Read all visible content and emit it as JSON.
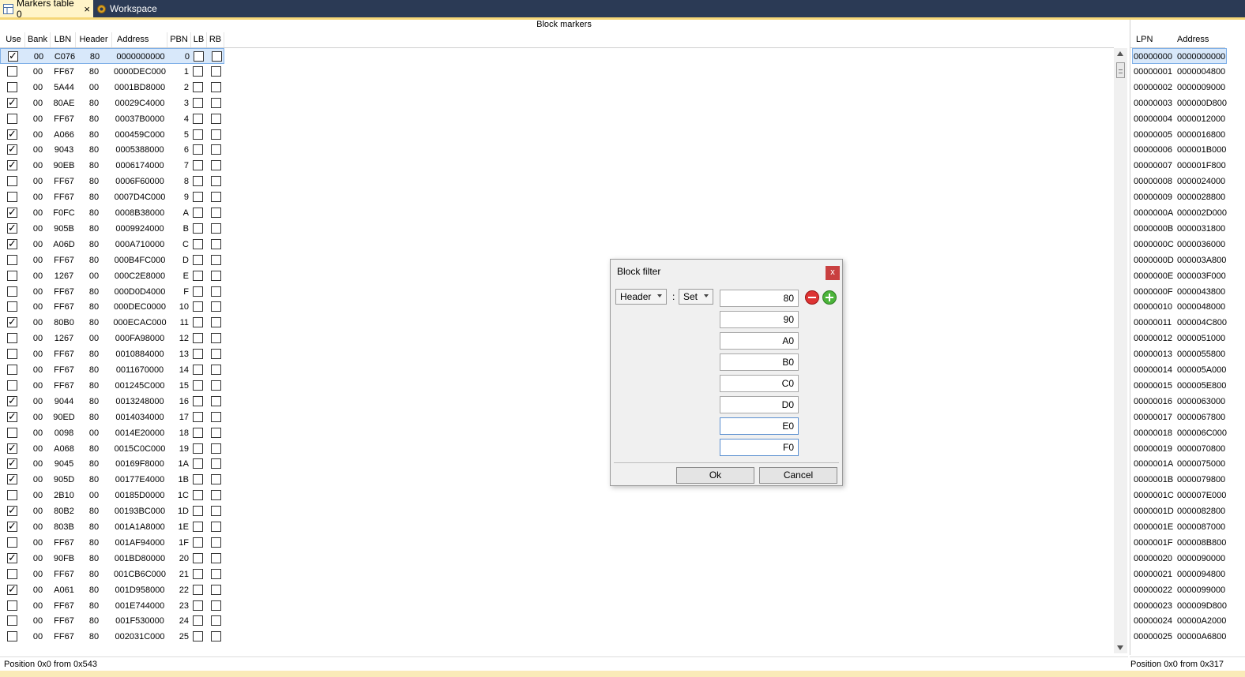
{
  "tabs": [
    {
      "label": "Markers table 0",
      "active": true,
      "close": "×"
    },
    {
      "label": "Workspace",
      "active": false
    }
  ],
  "block_markers": {
    "title": "Block markers",
    "columns": [
      "Use",
      "Bank",
      "LBN",
      "Header",
      "Address",
      "PBN",
      "LB",
      "RB"
    ],
    "rows": [
      {
        "use": true,
        "bank": "00",
        "lbn": "C076",
        "header": "80",
        "address": "0000000000",
        "pbn": "0"
      },
      {
        "use": false,
        "bank": "00",
        "lbn": "FF67",
        "header": "80",
        "address": "0000DEC000",
        "pbn": "1"
      },
      {
        "use": false,
        "bank": "00",
        "lbn": "5A44",
        "header": "00",
        "address": "0001BD8000",
        "pbn": "2"
      },
      {
        "use": true,
        "bank": "00",
        "lbn": "80AE",
        "header": "80",
        "address": "00029C4000",
        "pbn": "3"
      },
      {
        "use": false,
        "bank": "00",
        "lbn": "FF67",
        "header": "80",
        "address": "00037B0000",
        "pbn": "4"
      },
      {
        "use": true,
        "bank": "00",
        "lbn": "A066",
        "header": "80",
        "address": "000459C000",
        "pbn": "5"
      },
      {
        "use": true,
        "bank": "00",
        "lbn": "9043",
        "header": "80",
        "address": "0005388000",
        "pbn": "6"
      },
      {
        "use": true,
        "bank": "00",
        "lbn": "90EB",
        "header": "80",
        "address": "0006174000",
        "pbn": "7"
      },
      {
        "use": false,
        "bank": "00",
        "lbn": "FF67",
        "header": "80",
        "address": "0006F60000",
        "pbn": "8"
      },
      {
        "use": false,
        "bank": "00",
        "lbn": "FF67",
        "header": "80",
        "address": "0007D4C000",
        "pbn": "9"
      },
      {
        "use": true,
        "bank": "00",
        "lbn": "F0FC",
        "header": "80",
        "address": "0008B38000",
        "pbn": "A"
      },
      {
        "use": true,
        "bank": "00",
        "lbn": "905B",
        "header": "80",
        "address": "0009924000",
        "pbn": "B"
      },
      {
        "use": true,
        "bank": "00",
        "lbn": "A06D",
        "header": "80",
        "address": "000A710000",
        "pbn": "C"
      },
      {
        "use": false,
        "bank": "00",
        "lbn": "FF67",
        "header": "80",
        "address": "000B4FC000",
        "pbn": "D"
      },
      {
        "use": false,
        "bank": "00",
        "lbn": "1267",
        "header": "00",
        "address": "000C2E8000",
        "pbn": "E"
      },
      {
        "use": false,
        "bank": "00",
        "lbn": "FF67",
        "header": "80",
        "address": "000D0D4000",
        "pbn": "F"
      },
      {
        "use": false,
        "bank": "00",
        "lbn": "FF67",
        "header": "80",
        "address": "000DEC0000",
        "pbn": "10"
      },
      {
        "use": true,
        "bank": "00",
        "lbn": "80B0",
        "header": "80",
        "address": "000ECAC000",
        "pbn": "11"
      },
      {
        "use": false,
        "bank": "00",
        "lbn": "1267",
        "header": "00",
        "address": "000FA98000",
        "pbn": "12"
      },
      {
        "use": false,
        "bank": "00",
        "lbn": "FF67",
        "header": "80",
        "address": "0010884000",
        "pbn": "13"
      },
      {
        "use": false,
        "bank": "00",
        "lbn": "FF67",
        "header": "80",
        "address": "0011670000",
        "pbn": "14"
      },
      {
        "use": false,
        "bank": "00",
        "lbn": "FF67",
        "header": "80",
        "address": "001245C000",
        "pbn": "15"
      },
      {
        "use": true,
        "bank": "00",
        "lbn": "9044",
        "header": "80",
        "address": "0013248000",
        "pbn": "16"
      },
      {
        "use": true,
        "bank": "00",
        "lbn": "90ED",
        "header": "80",
        "address": "0014034000",
        "pbn": "17"
      },
      {
        "use": false,
        "bank": "00",
        "lbn": "0098",
        "header": "00",
        "address": "0014E20000",
        "pbn": "18"
      },
      {
        "use": true,
        "bank": "00",
        "lbn": "A068",
        "header": "80",
        "address": "0015C0C000",
        "pbn": "19"
      },
      {
        "use": true,
        "bank": "00",
        "lbn": "9045",
        "header": "80",
        "address": "00169F8000",
        "pbn": "1A"
      },
      {
        "use": true,
        "bank": "00",
        "lbn": "905D",
        "header": "80",
        "address": "00177E4000",
        "pbn": "1B"
      },
      {
        "use": false,
        "bank": "00",
        "lbn": "2B10",
        "header": "00",
        "address": "00185D0000",
        "pbn": "1C"
      },
      {
        "use": true,
        "bank": "00",
        "lbn": "80B2",
        "header": "80",
        "address": "00193BC000",
        "pbn": "1D"
      },
      {
        "use": true,
        "bank": "00",
        "lbn": "803B",
        "header": "80",
        "address": "001A1A8000",
        "pbn": "1E"
      },
      {
        "use": false,
        "bank": "00",
        "lbn": "FF67",
        "header": "80",
        "address": "001AF94000",
        "pbn": "1F"
      },
      {
        "use": true,
        "bank": "00",
        "lbn": "90FB",
        "header": "80",
        "address": "001BD80000",
        "pbn": "20"
      },
      {
        "use": false,
        "bank": "00",
        "lbn": "FF67",
        "header": "80",
        "address": "001CB6C000",
        "pbn": "21"
      },
      {
        "use": true,
        "bank": "00",
        "lbn": "A061",
        "header": "80",
        "address": "001D958000",
        "pbn": "22"
      },
      {
        "use": false,
        "bank": "00",
        "lbn": "FF67",
        "header": "80",
        "address": "001E744000",
        "pbn": "23"
      },
      {
        "use": false,
        "bank": "00",
        "lbn": "FF67",
        "header": "80",
        "address": "001F530000",
        "pbn": "24"
      },
      {
        "use": false,
        "bank": "00",
        "lbn": "FF67",
        "header": "80",
        "address": "002031C000",
        "pbn": "25"
      }
    ],
    "status": "Position 0x0 from 0x543"
  },
  "lpn_table": {
    "columns": [
      "LPN",
      "Address"
    ],
    "rows": [
      [
        "00000000",
        "0000000000"
      ],
      [
        "00000001",
        "0000004800"
      ],
      [
        "00000002",
        "0000009000"
      ],
      [
        "00000003",
        "000000D800"
      ],
      [
        "00000004",
        "0000012000"
      ],
      [
        "00000005",
        "0000016800"
      ],
      [
        "00000006",
        "000001B000"
      ],
      [
        "00000007",
        "000001F800"
      ],
      [
        "00000008",
        "0000024000"
      ],
      [
        "00000009",
        "0000028800"
      ],
      [
        "0000000A",
        "000002D000"
      ],
      [
        "0000000B",
        "0000031800"
      ],
      [
        "0000000C",
        "0000036000"
      ],
      [
        "0000000D",
        "000003A800"
      ],
      [
        "0000000E",
        "000003F000"
      ],
      [
        "0000000F",
        "0000043800"
      ],
      [
        "00000010",
        "0000048000"
      ],
      [
        "00000011",
        "000004C800"
      ],
      [
        "00000012",
        "0000051000"
      ],
      [
        "00000013",
        "0000055800"
      ],
      [
        "00000014",
        "000005A000"
      ],
      [
        "00000015",
        "000005E800"
      ],
      [
        "00000016",
        "0000063000"
      ],
      [
        "00000017",
        "0000067800"
      ],
      [
        "00000018",
        "000006C000"
      ],
      [
        "00000019",
        "0000070800"
      ],
      [
        "0000001A",
        "0000075000"
      ],
      [
        "0000001B",
        "0000079800"
      ],
      [
        "0000001C",
        "000007E000"
      ],
      [
        "0000001D",
        "0000082800"
      ],
      [
        "0000001E",
        "0000087000"
      ],
      [
        "0000001F",
        "000008B800"
      ],
      [
        "00000020",
        "0000090000"
      ],
      [
        "00000021",
        "0000094800"
      ],
      [
        "00000022",
        "0000099000"
      ],
      [
        "00000023",
        "000009D800"
      ],
      [
        "00000024",
        "00000A2000"
      ],
      [
        "00000025",
        "00000A6800"
      ]
    ],
    "status": "Position 0x0 from 0x317"
  },
  "dialog": {
    "title": "Block filter",
    "close": "x",
    "field_select": "Header",
    "colon": ":",
    "op_select": "Set",
    "values": [
      "80",
      "90",
      "A0",
      "B0",
      "C0",
      "D0",
      "E0",
      "F0"
    ],
    "ok": "Ok",
    "cancel": "Cancel"
  }
}
